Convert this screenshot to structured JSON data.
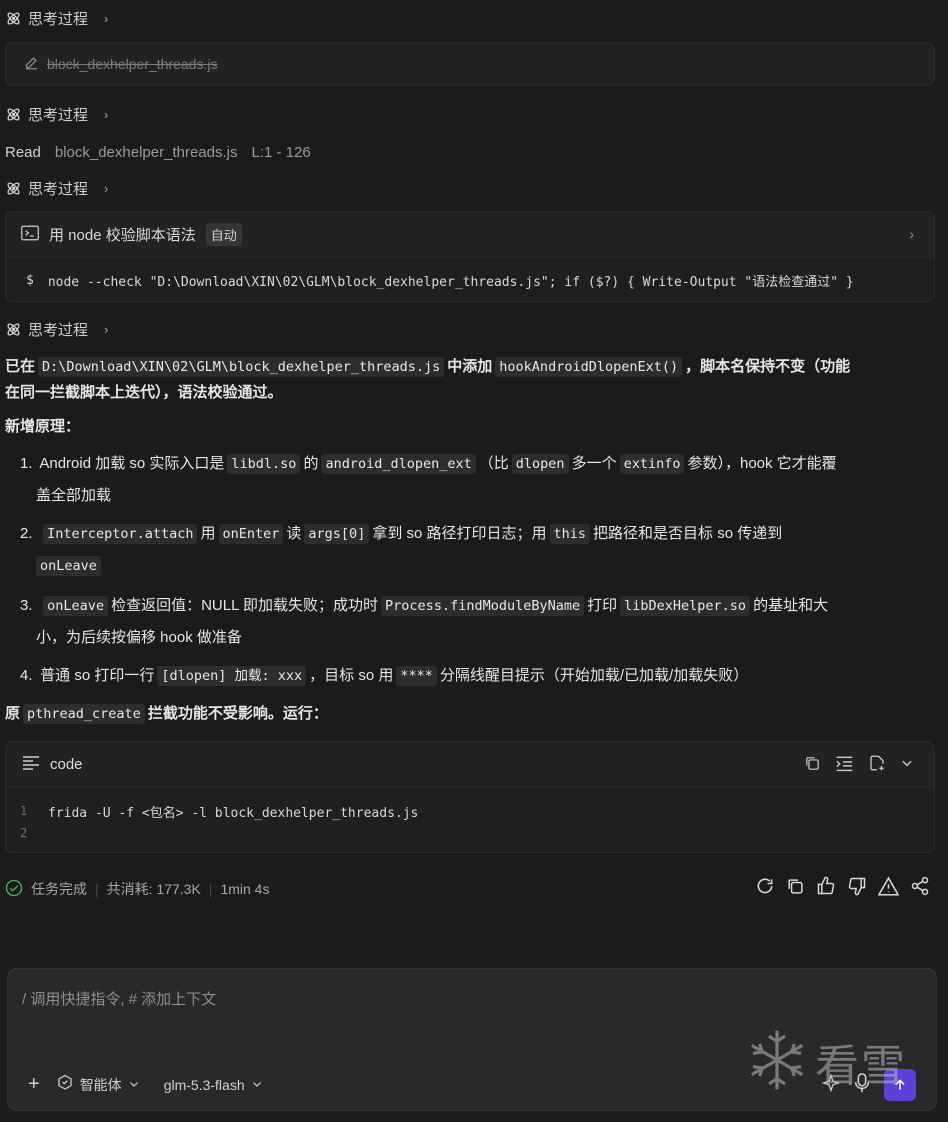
{
  "thinking_label": "思考过程",
  "file_card": {
    "filename": "block_dexhelper_threads.js"
  },
  "read_row": {
    "action": "Read",
    "file": "block_dexhelper_threads.js",
    "range": "L:1 - 126"
  },
  "terminal": {
    "title": "用 node 校验脚本语法",
    "badge": "自动",
    "prompt": "$",
    "command": "node --check \"D:\\Download\\XIN\\02\\GLM\\block_dexhelper_threads.js\"; if ($?) { Write-Output \"语法检查通过\" }"
  },
  "summary": {
    "p1_a": "已在",
    "p1_code1": "D:\\Download\\XIN\\02\\GLM\\block_dexhelper_threads.js",
    "p1_b": "中添加",
    "p1_code2": "hookAndroidDlopenExt()",
    "p1_c": "，脚本名保持不变（功能",
    "p1_d": "在同一拦截脚本上迭代），语法校验通过。",
    "heading": "新增原理：",
    "items": [
      {
        "num": "1.",
        "t1": "Android 加载 so 实际入口是",
        "c1": "libdl.so",
        "t2": "的",
        "c2": "android_dlopen_ext",
        "t3": "（比",
        "c3": "dlopen",
        "t4": "多一个",
        "c4": "extinfo",
        "t5": "参数），hook 它才能覆",
        "t6": "盖全部加载"
      },
      {
        "num": "2.",
        "c1": "Interceptor.attach",
        "t1": "用",
        "c2": "onEnter",
        "t2": "读",
        "c3": "args[0]",
        "t3": "拿到 so 路径打印日志；用",
        "c4": "this",
        "t4": "把路径和是否目标 so 传递到",
        "c5": "onLeave"
      },
      {
        "num": "3.",
        "c1": "onLeave",
        "t1": "检查返回值：NULL 即加载失败；成功时",
        "c2": "Process.findModuleByName",
        "t2": "打印",
        "c3": "libDexHelper.so",
        "t3": "的基址和大",
        "t4": "小，为后续按偏移 hook 做准备"
      },
      {
        "num": "4.",
        "t1": "普通 so 打印一行",
        "c1": "[dlopen] 加载: xxx",
        "t2": "，目标 so 用",
        "c2": "****",
        "t3": "分隔线醒目提示（开始加载/已加载/加载失败）"
      }
    ],
    "p2_a": "原",
    "p2_code": "pthread_create",
    "p2_b": "拦截功能不受影响。运行："
  },
  "code_block": {
    "lang": "code",
    "lines": [
      {
        "n": "1",
        "text": "frida -U -f <包名> -l block_dexhelper_threads.js"
      },
      {
        "n": "2",
        "text": ""
      }
    ]
  },
  "status": {
    "done": "任务完成",
    "usage": "共消耗: 177.3K",
    "time": "1min 4s"
  },
  "composer": {
    "placeholder": "/ 调用快捷指令, # 添加上下文",
    "agent": "智能体",
    "model": "glm-5.3-flash"
  },
  "watermark": "看雪",
  "colors": {
    "accent": "#5b3fd6",
    "success": "#3fb950"
  }
}
